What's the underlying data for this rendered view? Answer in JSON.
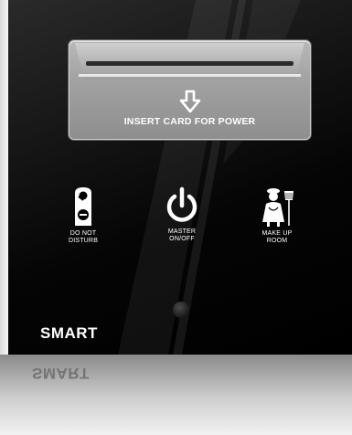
{
  "card_slot": {
    "label": "INSERT CARD FOR POWER",
    "arrow_icon": "down-arrow-icon"
  },
  "controls": [
    {
      "icon": "door-hanger-icon",
      "label_line1": "DO NOT",
      "label_line2": "DISTURB"
    },
    {
      "icon": "power-icon",
      "label_line1": "MASTER",
      "label_line2": "ON/OFF"
    },
    {
      "icon": "maid-icon",
      "label_line1": "MAKE UP",
      "label_line2": "ROOM"
    }
  ],
  "brand": {
    "text": "SMART",
    "reflection": "SMART"
  },
  "colors": {
    "panel": "#000000",
    "slot": "#a8a8a8",
    "text": "#ffffff"
  }
}
